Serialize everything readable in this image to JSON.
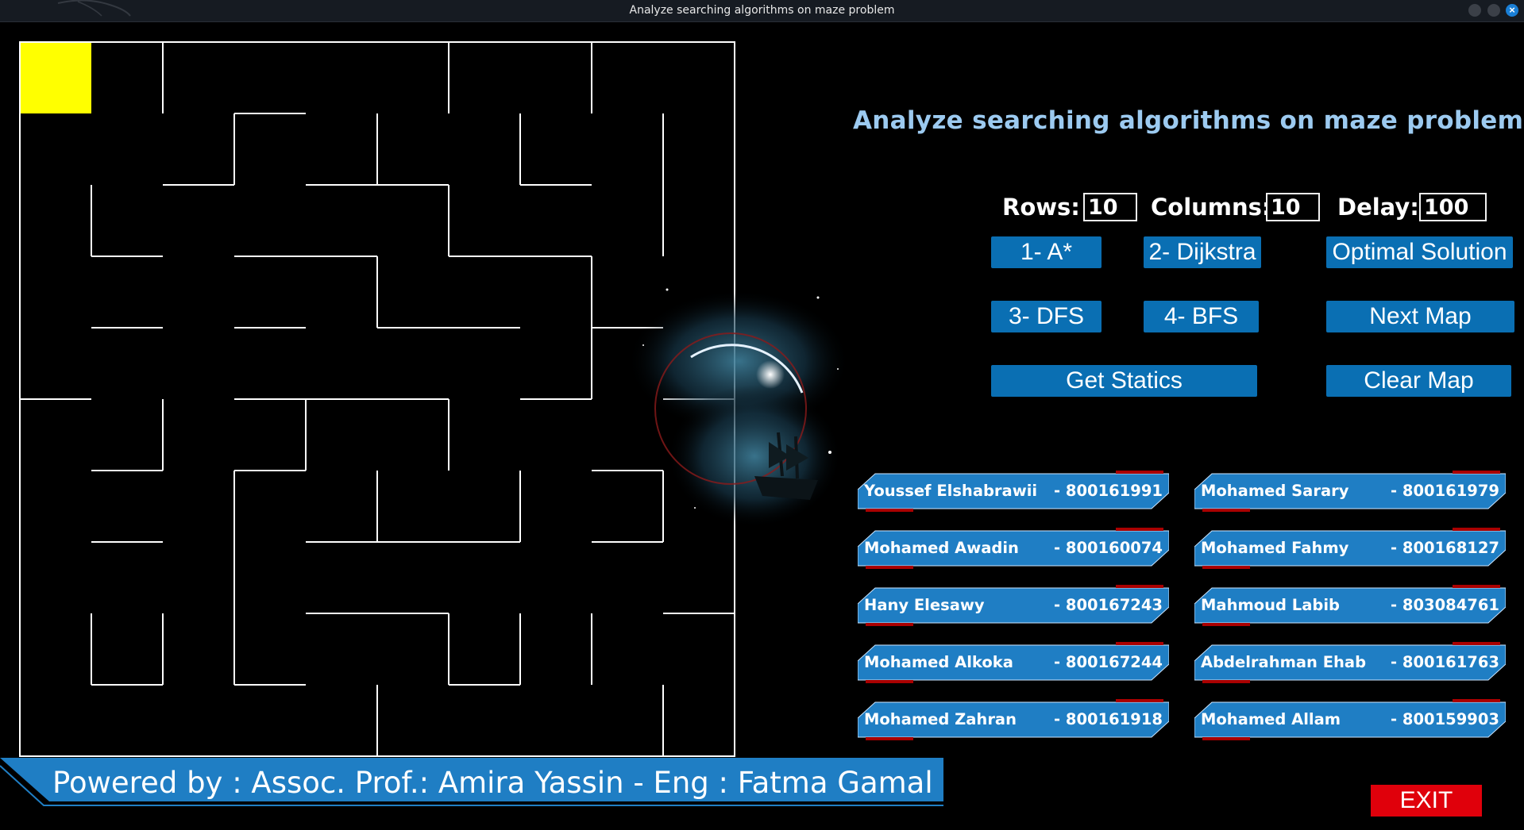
{
  "window": {
    "title": "Analyze searching algorithms on maze problem"
  },
  "app_title": "Analyze searching algorithms on maze problem",
  "controls": {
    "rows_label": "Rows:",
    "rows_value": "10",
    "columns_label": "Columns:",
    "columns_value": "10",
    "delay_label": "Delay:",
    "delay_value": "100"
  },
  "buttons": {
    "astar": "1- A*",
    "dijkstra": "2- Dijkstra",
    "optimal": "Optimal Solution",
    "dfs": "3- DFS",
    "bfs": "4- BFS",
    "next_map": "Next Map",
    "statics": "Get Statics",
    "clear_map": "Clear Map",
    "exit": "EXIT"
  },
  "maze": {
    "rows": 10,
    "cols": 10,
    "start_cell": {
      "row": 0,
      "col": 0
    },
    "start_color": "#ffff00",
    "wall_color": "#ffffff"
  },
  "team": [
    {
      "name": "Youssef Elshabrawii",
      "id": "- 800161991"
    },
    {
      "name": "Mohamed Sarary",
      "id": "- 800161979"
    },
    {
      "name": "Mohamed Awadin",
      "id": "- 800160074"
    },
    {
      "name": "Mohamed Fahmy",
      "id": "- 800168127"
    },
    {
      "name": "Hany Elesawy",
      "id": "- 800167243"
    },
    {
      "name": "Mahmoud Labib",
      "id": "- 803084761"
    },
    {
      "name": "Mohamed Alkoka",
      "id": "- 800167244"
    },
    {
      "name": "Abdelrahman Ehab",
      "id": "- 800161763"
    },
    {
      "name": "Mohamed Zahran",
      "id": "- 800161918"
    },
    {
      "name": "Mohamed Allam",
      "id": "- 800159903"
    }
  ],
  "footer": {
    "text": "Powered by :  Assoc. Prof.: Amira Yassin - Eng : Fatma Gamal"
  },
  "colors": {
    "accent": "#0a6fb3",
    "title": "#9ccaf0",
    "exit": "#e0000b",
    "card": "#1f7ec4"
  }
}
